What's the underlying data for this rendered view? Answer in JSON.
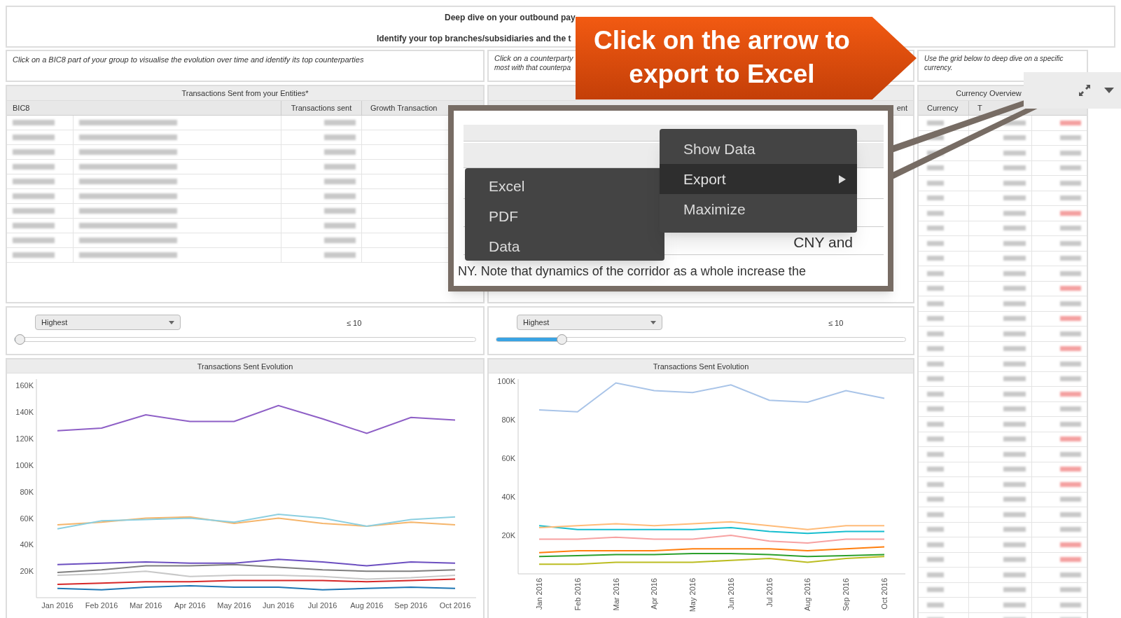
{
  "header": {
    "title": "Deep dive on your outbound pay",
    "subtitle": "Identify your top branches/subsidiaries and the t"
  },
  "callout": {
    "text": "Click on the arrow to export to Excel"
  },
  "panels": [
    {
      "instruction": "Click on a BIC8 part of your group to visualise the evolution over time and identify its top counterparties",
      "table": {
        "title": "Transactions Sent from your Entities*",
        "columns": [
          "BIC8",
          "Transactions sent",
          "Growth Transaction"
        ]
      },
      "slider": {
        "dropdown": "Highest",
        "limit": "≤ 10",
        "level": 0.01
      },
      "chart": {
        "title": "Transactions Sent Evolution",
        "chart_data": {
          "type": "line",
          "x": [
            "Jan 2016",
            "Feb 2016",
            "Mar 2016",
            "Apr 2016",
            "May 2016",
            "Jun 2016",
            "Jul 2016",
            "Aug 2016",
            "Sep 2016",
            "Oct 2016"
          ],
          "ylim": [
            0,
            165000
          ],
          "yticks": [
            {
              "value": 20000,
              "label": "20K"
            },
            {
              "value": 40000,
              "label": "40K"
            },
            {
              "value": 60000,
              "label": "60K"
            },
            {
              "value": 80000,
              "label": "80K"
            },
            {
              "value": 100000,
              "label": "100K"
            },
            {
              "value": 120000,
              "label": "120K"
            },
            {
              "value": 140000,
              "label": "140K"
            },
            {
              "value": 160000,
              "label": "160K"
            }
          ],
          "series": [
            {
              "color": "#8e5fc6",
              "values": [
                126000,
                128000,
                138000,
                133000,
                133000,
                145000,
                135000,
                124000,
                136000,
                134000
              ]
            },
            {
              "color": "#f5b56b",
              "values": [
                55000,
                57000,
                60000,
                61000,
                56000,
                60000,
                56000,
                54000,
                57000,
                55000
              ]
            },
            {
              "color": "#8ccfe0",
              "values": [
                52000,
                58000,
                59000,
                60000,
                57000,
                63000,
                60000,
                54000,
                59000,
                61000
              ]
            },
            {
              "color": "#7f7f7f",
              "values": [
                19000,
                21000,
                24000,
                24000,
                25000,
                23000,
                21000,
                20000,
                20000,
                21000
              ]
            },
            {
              "color": "#6c4fc0",
              "values": [
                25000,
                26000,
                27000,
                26000,
                26000,
                29000,
                27000,
                24000,
                27000,
                26000
              ]
            },
            {
              "color": "#c8c8c8",
              "values": [
                17000,
                18000,
                20000,
                16000,
                17000,
                17000,
                16000,
                14000,
                15000,
                17000
              ]
            },
            {
              "color": "#d62728",
              "values": [
                10000,
                11000,
                12000,
                12000,
                13000,
                13000,
                13000,
                12000,
                13000,
                14000
              ]
            },
            {
              "color": "#1f77b4",
              "values": [
                7000,
                6000,
                8000,
                9000,
                8000,
                8000,
                6000,
                7000,
                8000,
                7000
              ]
            }
          ]
        }
      }
    },
    {
      "instruction": "Click on a counterparty",
      "instruction_2": "most with that counterpa",
      "table": {
        "columns": [
          "ent"
        ]
      },
      "slider": {
        "dropdown": "Highest",
        "limit": "≤ 10",
        "level": 0.16
      },
      "chart": {
        "title": "Transactions Sent Evolution",
        "chart_data": {
          "type": "line",
          "x": [
            "Jan 2016",
            "Feb 2016",
            "Mar 2016",
            "Apr 2016",
            "May 2016",
            "Jun 2016",
            "Jul 2016",
            "Aug 2016",
            "Sep 2016",
            "Oct 2016"
          ],
          "ylim": [
            0,
            101000
          ],
          "yticks": [
            {
              "value": 20000,
              "label": "20K"
            },
            {
              "value": 40000,
              "label": "40K"
            },
            {
              "value": 60000,
              "label": "60K"
            },
            {
              "value": 80000,
              "label": "80K"
            },
            {
              "value": 100000,
              "label": "100K"
            }
          ],
          "series": [
            {
              "color": "#a9c4e8",
              "values": [
                85000,
                84000,
                99000,
                95000,
                94000,
                98000,
                90000,
                89000,
                95000,
                91000
              ]
            },
            {
              "color": "#17becf",
              "values": [
                25000,
                23000,
                23000,
                23000,
                23000,
                24000,
                22000,
                21000,
                22000,
                22000
              ]
            },
            {
              "color": "#ffbb78",
              "values": [
                24000,
                25000,
                26000,
                25000,
                26000,
                27000,
                25000,
                23000,
                25000,
                25000
              ]
            },
            {
              "color": "#f7a1a1",
              "values": [
                18000,
                18000,
                19000,
                18000,
                18000,
                20000,
                17000,
                16000,
                18000,
                18000
              ]
            },
            {
              "color": "#ff7f0e",
              "values": [
                11000,
                12000,
                12000,
                12000,
                13000,
                13000,
                13000,
                12000,
                13000,
                14000
              ]
            },
            {
              "color": "#2ca02c",
              "values": [
                9000,
                9500,
                10000,
                10000,
                10500,
                10500,
                10000,
                9000,
                9500,
                10000
              ]
            },
            {
              "color": "#bcbd22",
              "values": [
                5000,
                5000,
                6000,
                6000,
                6000,
                7000,
                8000,
                6000,
                8000,
                9000
              ]
            }
          ]
        }
      }
    }
  ],
  "currency_panel": {
    "instruction": "Use the grid below to deep dive on a specific currency.",
    "title": "Currency Overview",
    "columns": [
      "Currency",
      "T"
    ]
  },
  "inset": {
    "fragments": [
      "CNY and",
      "NY. Note that dynamics of the corridor as a whole increase the"
    ]
  },
  "context_menu": {
    "items": [
      {
        "label": "Show Data",
        "selected": false,
        "submenu": false
      },
      {
        "label": "Export",
        "selected": true,
        "submenu": true
      },
      {
        "label": "Maximize",
        "selected": false,
        "submenu": false
      }
    ],
    "submenu": [
      {
        "label": "Excel"
      },
      {
        "label": "PDF"
      },
      {
        "label": "Data"
      }
    ]
  }
}
